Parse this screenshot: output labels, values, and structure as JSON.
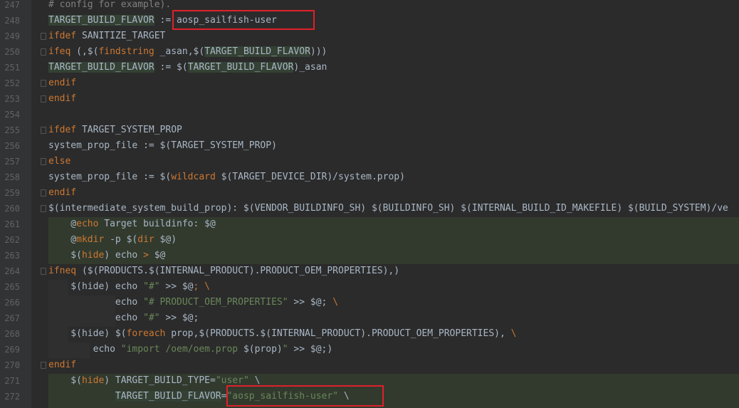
{
  "editor": {
    "colors": {
      "background": "#2b2b2b",
      "gutter": "#313335",
      "keyword": "#cc7832",
      "function": "#ffc66d",
      "string": "#6a8759",
      "comment": "#808080",
      "identifier_highlight": "#344134",
      "annotation_box": "#e0202a"
    },
    "lines": [
      {
        "num": "247",
        "parts": [
          {
            "t": "# config for example).",
            "c": "cmt"
          }
        ]
      },
      {
        "num": "248",
        "parts": [
          {
            "t": "TARGET_BUILD_FLAVOR",
            "c": "var"
          },
          {
            "t": " := ",
            "c": ""
          },
          {
            "t": "aosp_sailfish-user",
            "c": ""
          }
        ]
      },
      {
        "num": "249",
        "parts": [
          {
            "t": "ifdef",
            "c": "kw"
          },
          {
            "t": " SANITIZE_TARGET",
            "c": ""
          }
        ]
      },
      {
        "num": "250",
        "parts": [
          {
            "t": "ifeq",
            "c": "kw"
          },
          {
            "t": " (,$(",
            "c": ""
          },
          {
            "t": "findstring",
            "c": "kw"
          },
          {
            "t": " _asan,$(",
            "c": ""
          },
          {
            "t": "TARGET_BUILD_FLAVOR",
            "c": "var"
          },
          {
            "t": ")))",
            "c": ""
          }
        ]
      },
      {
        "num": "251",
        "parts": [
          {
            "t": "TARGET_BUILD_FLAVOR",
            "c": "var"
          },
          {
            "t": " := $(",
            "c": ""
          },
          {
            "t": "TARGET_BUILD_FLAVOR",
            "c": "var"
          },
          {
            "t": ")_asan",
            "c": ""
          }
        ]
      },
      {
        "num": "252",
        "parts": [
          {
            "t": "endif",
            "c": "kw"
          }
        ]
      },
      {
        "num": "253",
        "parts": [
          {
            "t": "endif",
            "c": "kw"
          }
        ]
      },
      {
        "num": "254",
        "parts": []
      },
      {
        "num": "255",
        "parts": [
          {
            "t": "ifdef",
            "c": "kw"
          },
          {
            "t": " TARGET_SYSTEM_PROP",
            "c": ""
          }
        ]
      },
      {
        "num": "256",
        "parts": [
          {
            "t": "system_prop_file := $(TARGET_SYSTEM_PROP)",
            "c": ""
          }
        ]
      },
      {
        "num": "257",
        "parts": [
          {
            "t": "else",
            "c": "kw"
          }
        ]
      },
      {
        "num": "258",
        "parts": [
          {
            "t": "system_prop_file := $(",
            "c": ""
          },
          {
            "t": "wildcard",
            "c": "kw"
          },
          {
            "t": " $(TARGET_DEVICE_DIR)/system.prop)",
            "c": ""
          }
        ]
      },
      {
        "num": "259",
        "parts": [
          {
            "t": "endif",
            "c": "kw"
          }
        ]
      },
      {
        "num": "260",
        "parts": [
          {
            "t": "$(intermediate_system_build_prop): $(VENDOR_BUILDINFO_SH) $(BUILDINFO_SH) $(INTERNAL_BUILD_ID_MAKEFILE) $(BUILD_SYSTEM)/ve",
            "c": ""
          }
        ]
      },
      {
        "num": "261",
        "parts": [
          {
            "t": "    @",
            "c": ""
          },
          {
            "t": "echo",
            "c": "kw"
          },
          {
            "t": " Target buildinfo: $@",
            "c": ""
          }
        ]
      },
      {
        "num": "262",
        "parts": [
          {
            "t": "    @",
            "c": ""
          },
          {
            "t": "mkdir",
            "c": "kw"
          },
          {
            "t": " -p $(",
            "c": ""
          },
          {
            "t": "dir",
            "c": "kw"
          },
          {
            "t": " $@)",
            "c": ""
          }
        ]
      },
      {
        "num": "263",
        "parts": [
          {
            "t": "    $(",
            "c": ""
          },
          {
            "t": "hide",
            "c": "kw"
          },
          {
            "t": ") echo ",
            "c": ""
          },
          {
            "t": ">",
            "c": "kw"
          },
          {
            "t": " $@",
            "c": ""
          }
        ]
      },
      {
        "num": "264",
        "parts": [
          {
            "t": "ifneq",
            "c": "kw"
          },
          {
            "t": " ($(PRODUCTS.$(INTERNAL_PRODUCT).PRODUCT_OEM_PROPERTIES),)",
            "c": ""
          }
        ]
      },
      {
        "num": "265",
        "parts": [
          {
            "t": "    $(hide) echo ",
            "c": ""
          },
          {
            "t": "\"#\"",
            "c": "str"
          },
          {
            "t": " >> ",
            "c": ""
          },
          {
            "t": "$@",
            "c": ""
          },
          {
            "t": "; \\",
            "c": "kw"
          }
        ]
      },
      {
        "num": "266",
        "parts": [
          {
            "t": "            echo ",
            "c": ""
          },
          {
            "t": "\"# PRODUCT_OEM_PROPERTIES\"",
            "c": "str"
          },
          {
            "t": " >> $@; ",
            "c": ""
          },
          {
            "t": "\\",
            "c": "kw"
          }
        ]
      },
      {
        "num": "267",
        "parts": [
          {
            "t": "            echo ",
            "c": ""
          },
          {
            "t": "\"#\"",
            "c": "str"
          },
          {
            "t": " >> $@;",
            "c": ""
          }
        ]
      },
      {
        "num": "268",
        "parts": [
          {
            "t": "    $(hide) $(",
            "c": ""
          },
          {
            "t": "foreach",
            "c": "kw"
          },
          {
            "t": " prop,$(PRODUCTS.$(INTERNAL_PRODUCT).PRODUCT_OEM_PROPERTIES), ",
            "c": ""
          },
          {
            "t": "\\",
            "c": "kw"
          }
        ]
      },
      {
        "num": "269",
        "parts": [
          {
            "t": "        echo ",
            "c": ""
          },
          {
            "t": "\"import /oem/oem.prop ",
            "c": "str"
          },
          {
            "t": "$(prop)",
            "c": ""
          },
          {
            "t": "\"",
            "c": "str"
          },
          {
            "t": " >> $@;)",
            "c": ""
          }
        ]
      },
      {
        "num": "270",
        "parts": [
          {
            "t": "endif",
            "c": "kw"
          }
        ]
      },
      {
        "num": "271",
        "parts": [
          {
            "t": "    $(",
            "c": ""
          },
          {
            "t": "hide",
            "c": "kw"
          },
          {
            "t": ") TARGET_BUILD_TYPE=",
            "c": ""
          },
          {
            "t": "\"user\"",
            "c": "str"
          },
          {
            "t": " \\",
            "c": ""
          }
        ]
      },
      {
        "num": "272",
        "parts": [
          {
            "t": "            ",
            "c": ""
          },
          {
            "t": "TARGET_BUILD_FLAVOR",
            "c": "var"
          },
          {
            "t": "=",
            "c": ""
          },
          {
            "t": "\"aosp_sailfish-user\"",
            "c": "str"
          },
          {
            "t": " \\",
            "c": ""
          }
        ]
      }
    ]
  }
}
